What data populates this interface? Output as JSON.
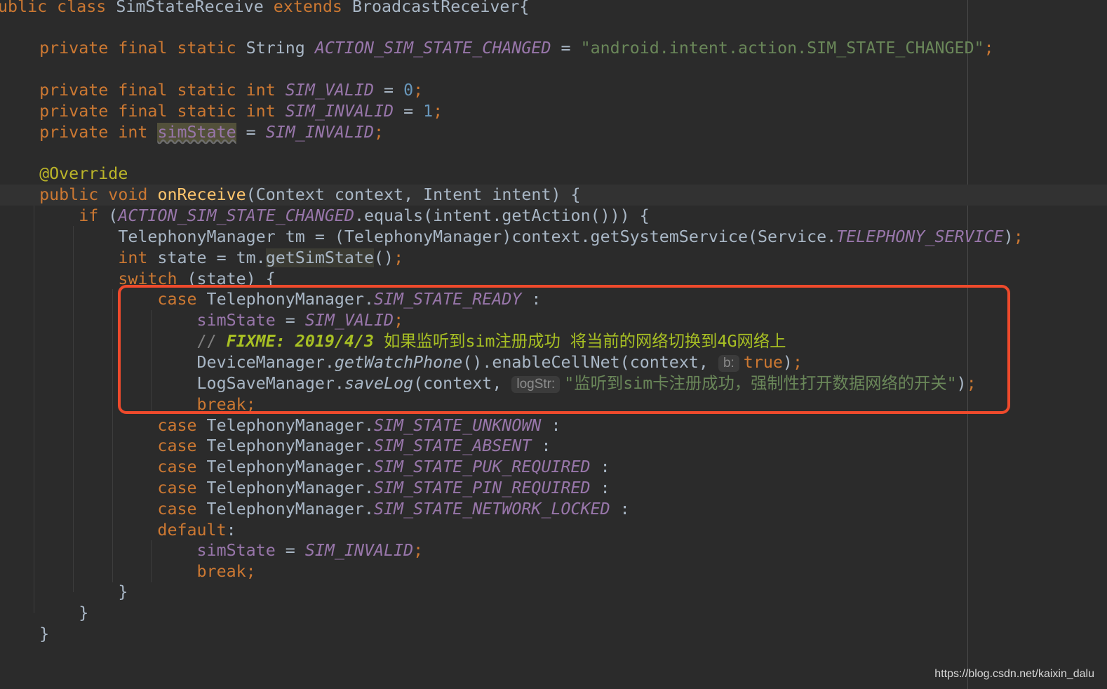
{
  "code": {
    "class_decl": {
      "k_public": "ublic",
      "k_class": "class",
      "name": "SimStateReceive",
      "k_extends": "extends",
      "parent": "BroadcastReceiver{"
    },
    "field_action": {
      "mods": "private final static",
      "type": "String",
      "name": "ACTION_SIM_STATE_CHANGED",
      "eq": " = ",
      "value": "\"android.intent.action.SIM_STATE_CHANGED\"",
      "semi": ";"
    },
    "field_valid": {
      "mods": "private final static int",
      "name": "SIM_VALID",
      "eq": " = ",
      "value": "0",
      "semi": ";"
    },
    "field_invalid": {
      "mods": "private final static int",
      "name": "SIM_INVALID",
      "eq": " = ",
      "value": "1",
      "semi": ";"
    },
    "field_state": {
      "mods": "private int",
      "name": "simState",
      "eq": " = ",
      "value": "SIM_INVALID",
      "semi": ";"
    },
    "annotation": "@Override",
    "method_decl": {
      "mods": "public void",
      "name": "onReceive",
      "params": "(Context context, Intent intent) {"
    },
    "if_line": {
      "k_if": "if",
      "open": " (",
      "const": "ACTION_SIM_STATE_CHANGED",
      "rest": ".equals(intent.getAction())) {"
    },
    "tm_line": {
      "text": "TelephonyManager tm = (TelephonyManager)context.getSystemService(Service.",
      "const": "TELEPHONY_SERVICE",
      "close": ")",
      "semi": ";"
    },
    "state_line": {
      "k_int": "int",
      "pre": " state = tm.",
      "method": "getSimState",
      "post": "()",
      "semi": ";"
    },
    "switch_line": {
      "k_switch": "switch",
      "rest": " (state) {"
    },
    "case_ready": {
      "k_case": "case",
      "cls": " TelephonyManager.",
      "const": "SIM_STATE_READY",
      "colon": " :"
    },
    "assign_valid": {
      "field": "simState",
      "eq": " = ",
      "const": "SIM_VALID",
      "semi": ";"
    },
    "comment": {
      "slashes": "// ",
      "tag": "FIXME:",
      "date": " 2019/4/3",
      "text": " 如果监听到sim注册成功 将当前的网络切换到4G网络上"
    },
    "device_line": {
      "pre": "DeviceManager.",
      "method": "getWatchPhone",
      "mid": "().enableCellNet(context, ",
      "hint": "b:",
      "value": "true",
      "close": ")",
      "semi": ";"
    },
    "log_line": {
      "pre": "LogSaveManager.",
      "method": "saveLog",
      "mid": "(context, ",
      "hint": "logStr:",
      "value": "\"监听到sim卡注册成功，强制性打开数据网络的开关\"",
      "close": ")",
      "semi": ";"
    },
    "break_1": "break;",
    "other_cases": [
      {
        "k_case": "case",
        "cls": " TelephonyManager.",
        "const": "SIM_STATE_UNKNOWN",
        "colon": " :"
      },
      {
        "k_case": "case",
        "cls": " TelephonyManager.",
        "const": "SIM_STATE_ABSENT",
        "colon": " :"
      },
      {
        "k_case": "case",
        "cls": " TelephonyManager.",
        "const": "SIM_STATE_PUK_REQUIRED",
        "colon": " :"
      },
      {
        "k_case": "case",
        "cls": " TelephonyManager.",
        "const": "SIM_STATE_PIN_REQUIRED",
        "colon": " :"
      },
      {
        "k_case": "case",
        "cls": " TelephonyManager.",
        "const": "SIM_STATE_NETWORK_LOCKED",
        "colon": " :"
      }
    ],
    "default_line": {
      "k_default": "default",
      "colon": ":"
    },
    "assign_invalid": {
      "field": "simState",
      "eq": " = ",
      "const": "SIM_INVALID",
      "semi": ";"
    },
    "break_2": "break;",
    "brace": "}"
  },
  "watermark": "https://blog.csdn.net/kaixin_dalu",
  "colors": {
    "background": "#2b2b2b",
    "keyword": "#cc7832",
    "string": "#6a8759",
    "number": "#6897bb",
    "constant": "#9876aa",
    "method": "#ffc66d",
    "annotation": "#bbb529",
    "todo": "#a8c023",
    "highlight_box": "#ee4a2c"
  }
}
